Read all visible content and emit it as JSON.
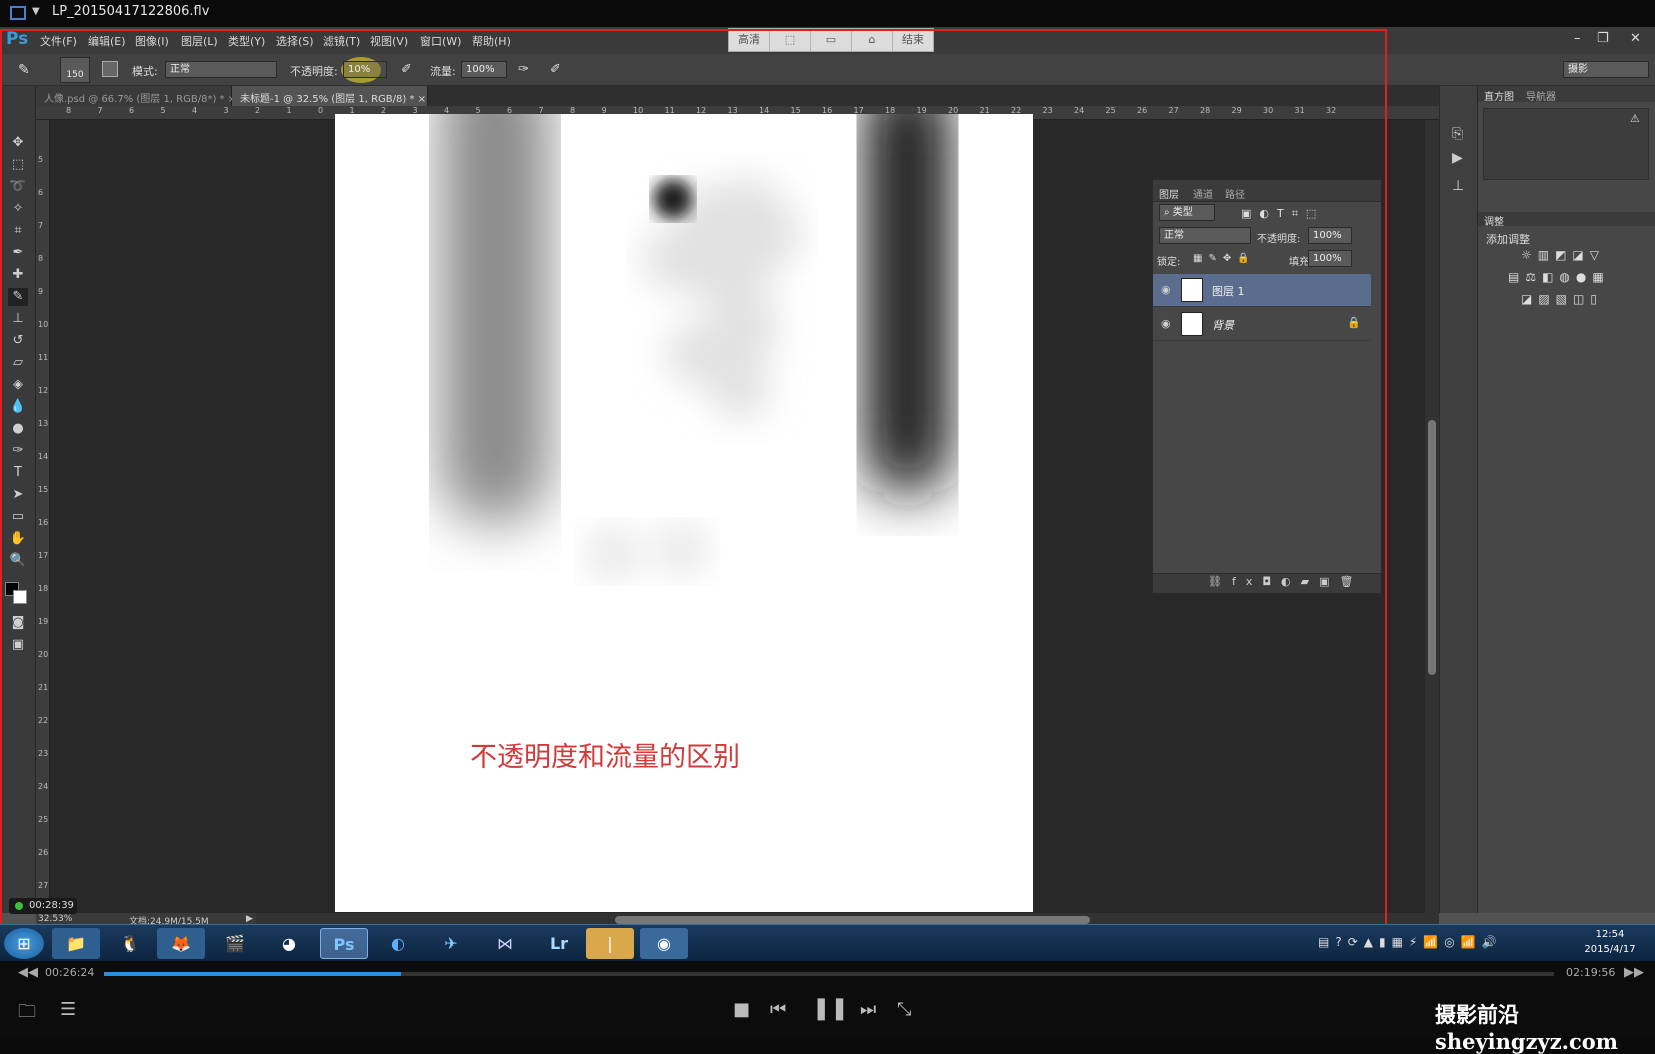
{
  "player": {
    "filename": "LP_20150417122806.flv",
    "elapsed": "00:26:24",
    "duration": "02:19:56",
    "progress_fraction": 0.205,
    "recording_timer": "00:28:39",
    "watermark": "摄影前沿sheyingzyz.com"
  },
  "recorder_toolbar": {
    "hd_label": "高清",
    "end_label": "结束"
  },
  "ps": {
    "logo": "Ps",
    "menu": [
      "文件(F)",
      "编辑(E)",
      "图像(I)",
      "图层(L)",
      "类型(Y)",
      "选择(S)",
      "滤镜(T)",
      "视图(V)",
      "窗口(W)",
      "帮助(H)"
    ],
    "workspace": "摄影",
    "options": {
      "brush_size": "150",
      "mode_label": "模式:",
      "mode_value": "正常",
      "opacity_label": "不透明度:",
      "opacity_value": "10%",
      "flow_label": "流量:",
      "flow_value": "100%"
    },
    "tabs": [
      {
        "label": "人像.psd @ 66.7% (图层 1, RGB/8*) *",
        "active": false
      },
      {
        "label": "未标题-1 @ 32.5% (图层 1, RGB/8) *",
        "active": true
      }
    ],
    "ruler_top": [
      "8",
      "7",
      "6",
      "5",
      "4",
      "3",
      "2",
      "1",
      "0",
      "1",
      "2",
      "3",
      "4",
      "5",
      "6",
      "7",
      "8",
      "9",
      "10",
      "11",
      "12",
      "13",
      "14",
      "15",
      "16",
      "17",
      "18",
      "19",
      "20",
      "21",
      "22",
      "23",
      "24",
      "25",
      "26",
      "27",
      "28",
      "29",
      "30",
      "31",
      "32"
    ],
    "ruler_left": [
      "5",
      "6",
      "7",
      "8",
      "9",
      "10",
      "11",
      "12",
      "13",
      "14",
      "15",
      "16",
      "17",
      "18",
      "19",
      "20",
      "21",
      "22",
      "23",
      "24",
      "25",
      "26",
      "27"
    ],
    "canvas_text": "不透明度和流量的区别",
    "status": {
      "zoom": "32.53%",
      "doc": "文档:24.9M/15.5M"
    },
    "layers_panel": {
      "tabs": [
        "图层",
        "通道",
        "路径"
      ],
      "filter": "类型",
      "blend": "正常",
      "opacity_label": "不透明度:",
      "opacity_value": "100%",
      "lock_label": "锁定:",
      "fill_label": "填充:",
      "fill_value": "100%",
      "layers": [
        {
          "name": "图层 1",
          "selected": true
        },
        {
          "name": "背景",
          "selected": false
        }
      ]
    },
    "right_panel": {
      "tabs": [
        "直方图",
        "导航器"
      ],
      "adjust_tab": "调整",
      "adjust_title": "添加调整"
    }
  },
  "taskbar": {
    "time": "12:54",
    "date": "2015/4/17"
  }
}
